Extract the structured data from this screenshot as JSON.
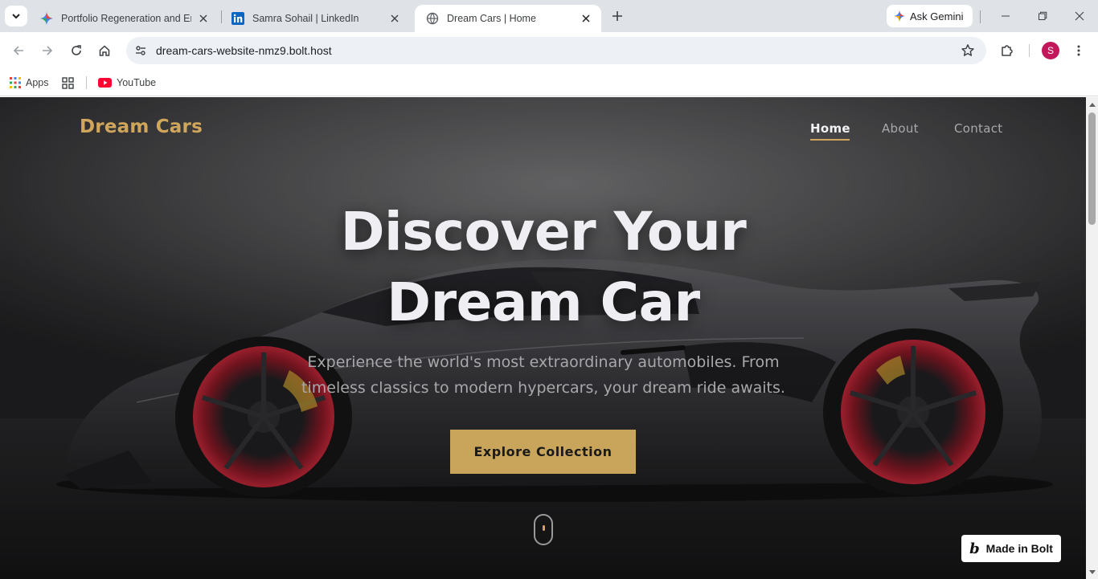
{
  "browser": {
    "tabs": [
      {
        "title": "Portfolio Regeneration and Enh",
        "favicon": "gemini-icon",
        "active": false
      },
      {
        "title": "Samra Sohail | LinkedIn",
        "favicon": "linkedin-icon",
        "active": false
      },
      {
        "title": "Dream Cars | Home",
        "favicon": "globe-icon",
        "active": true
      }
    ],
    "ask_gemini": "Ask Gemini",
    "url": "dream-cars-website-nmz9.bolt.host",
    "profile_initial": "S",
    "bookmarks": [
      {
        "label": "Apps",
        "icon": "apps-grid-icon"
      },
      {
        "label": "",
        "icon": "tab-groups-icon"
      },
      {
        "label": "YouTube",
        "icon": "youtube-icon"
      }
    ]
  },
  "site": {
    "logo": "Dream Cars",
    "nav": [
      {
        "label": "Home",
        "active": true
      },
      {
        "label": "About",
        "active": false
      },
      {
        "label": "Contact",
        "active": false
      }
    ],
    "hero": {
      "title_line1": "Discover Your",
      "title_line2": "Dream Car",
      "subtitle_line1": "Experience the world's most extraordinary automobiles. From",
      "subtitle_line2": "timeless classics to modern hypercars, your dream ride awaits.",
      "cta": "Explore Collection"
    },
    "badge": "Made in Bolt"
  },
  "colors": {
    "accent": "#c9a55c",
    "brake_calipers": "#b8912e",
    "rims": "#a0202c"
  }
}
